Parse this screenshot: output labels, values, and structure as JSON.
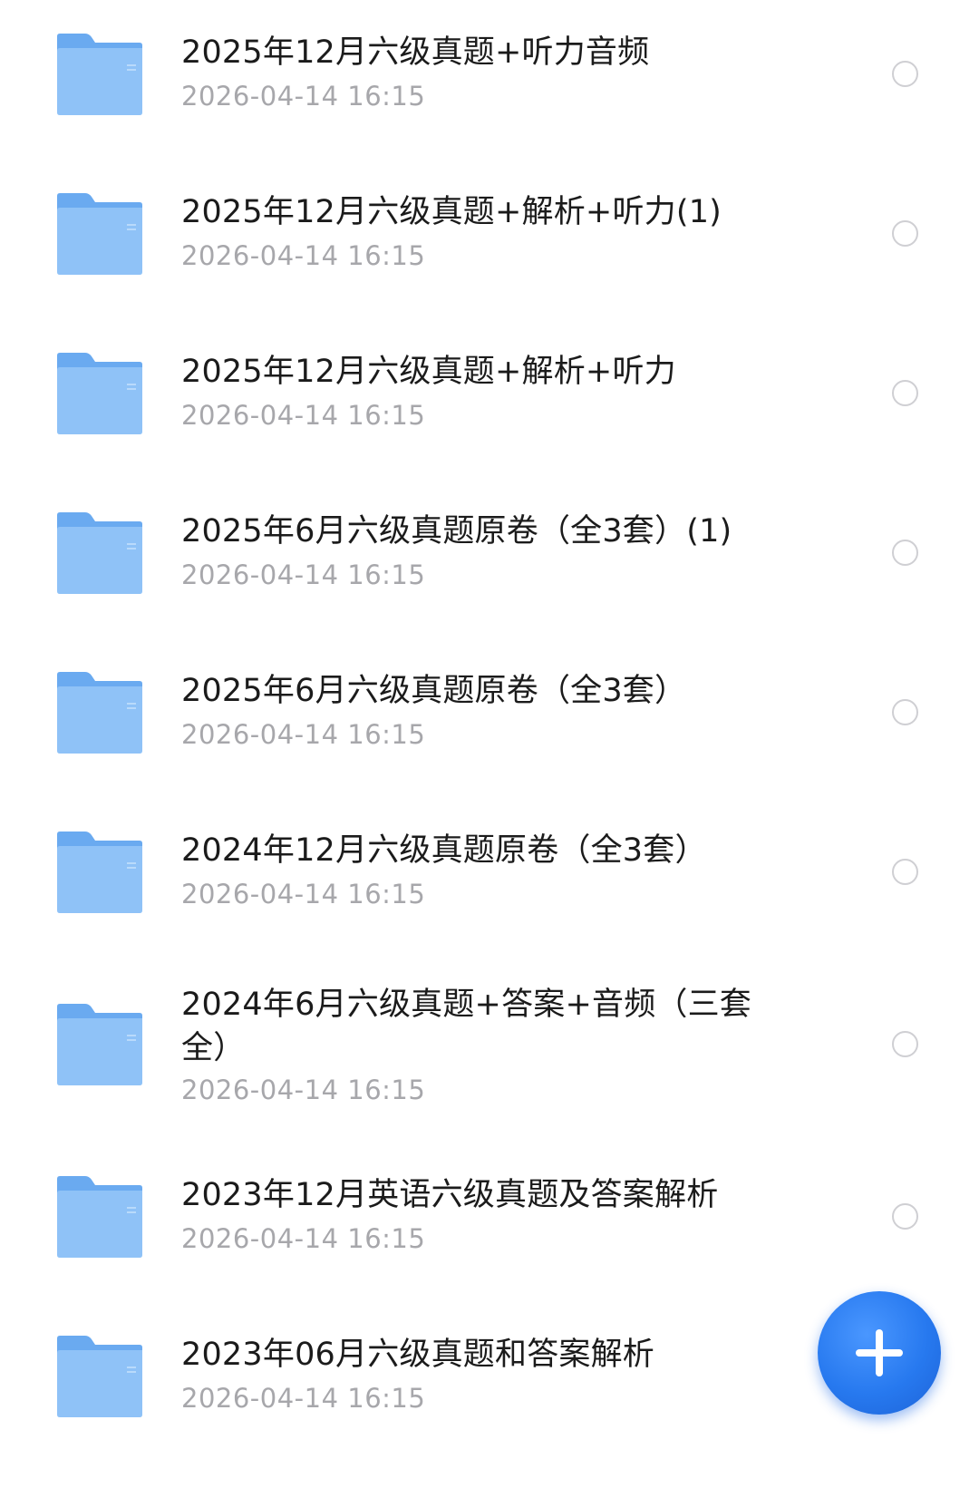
{
  "files": [
    {
      "name": "2025年12月六级真题+听力音频",
      "date": "2026-04-14 16:15"
    },
    {
      "name": "2025年12月六级真题+解析+听力(1)",
      "date": "2026-04-14 16:15"
    },
    {
      "name": "2025年12月六级真题+解析+听力",
      "date": "2026-04-14 16:15"
    },
    {
      "name": "2025年6月六级真题原卷（全3套）(1)",
      "date": "2026-04-14 16:15"
    },
    {
      "name": "2025年6月六级真题原卷（全3套）",
      "date": "2026-04-14 16:15"
    },
    {
      "name": "2024年12月六级真题原卷（全3套）",
      "date": "2026-04-14 16:15"
    },
    {
      "name": "2024年6月六级真题+答案+音频（三套全）",
      "date": "2026-04-14 16:15"
    },
    {
      "name": "2023年12月英语六级真题及答案解析",
      "date": "2026-04-14 16:15"
    },
    {
      "name": "2023年06月六级真题和答案解析",
      "date": "2026-04-14 16:15"
    }
  ],
  "icons": {
    "folder": "folder-icon",
    "select": "radio-circle-icon",
    "add": "plus-icon"
  },
  "colors": {
    "folder_front": "#8fc2f7",
    "folder_back": "#6aaaf0",
    "fab": "#2779ef",
    "date_text": "#a7a7ab"
  }
}
